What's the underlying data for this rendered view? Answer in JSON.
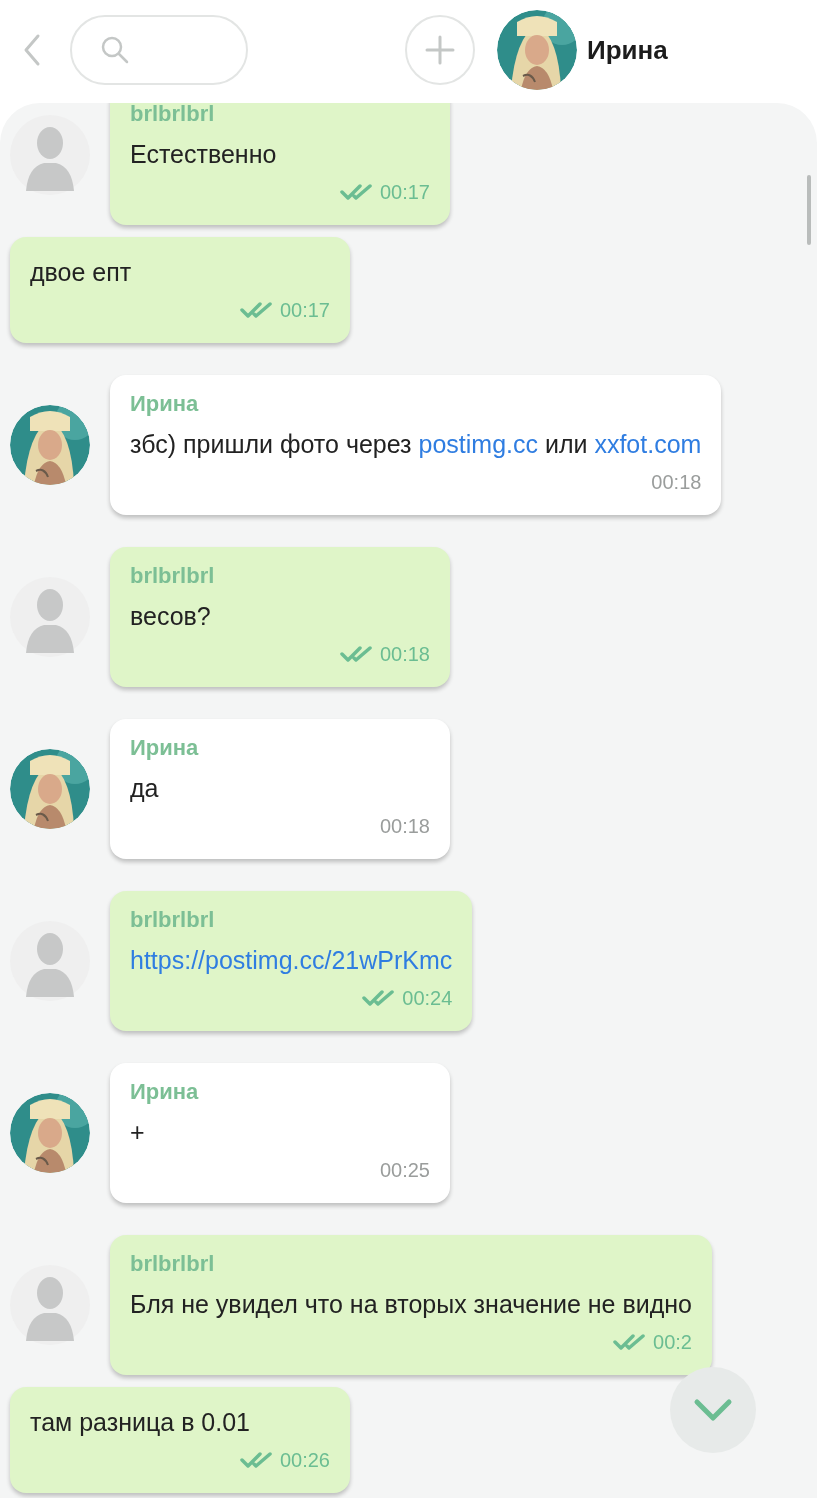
{
  "header": {
    "contact_name": "Ирина"
  },
  "messages": [
    {
      "kind": "own",
      "sender": "brlbrlbrl",
      "parts": [
        {
          "text": "Естественно"
        }
      ],
      "time": "00:17",
      "read": true
    },
    {
      "kind": "own_plain",
      "parts": [
        {
          "text": "двое епт"
        }
      ],
      "time": "00:17",
      "read": true
    },
    {
      "kind": "other",
      "sender": "Ирина",
      "parts": [
        {
          "text": "збс) пришли фото через "
        },
        {
          "text": "postimg.cc",
          "kind": "link"
        },
        {
          "text": " или "
        },
        {
          "text": "xxfot.com",
          "kind": "link"
        }
      ],
      "time": "00:18"
    },
    {
      "kind": "own",
      "sender": "brlbrlbrl",
      "parts": [
        {
          "text": "весов?"
        }
      ],
      "time": "00:18",
      "read": true
    },
    {
      "kind": "other",
      "sender": "Ирина",
      "parts": [
        {
          "text": "да"
        }
      ],
      "time": "00:18"
    },
    {
      "kind": "own",
      "sender": "brlbrlbrl",
      "parts": [
        {
          "text": "https://postimg.cc/21wPrKmc",
          "kind": "link"
        }
      ],
      "time": "00:24",
      "read": true
    },
    {
      "kind": "other",
      "sender": "Ирина",
      "parts": [
        {
          "text": "+"
        }
      ],
      "time": "00:25"
    },
    {
      "kind": "own",
      "sender": "brlbrlbrl",
      "parts": [
        {
          "text": "Бля не увидел что на вторых значение не видно"
        }
      ],
      "time": "00:2",
      "read": true
    },
    {
      "kind": "own_plain",
      "parts": [
        {
          "text": "там разница в 0.01"
        }
      ],
      "time": "00:26",
      "read": true
    }
  ]
}
